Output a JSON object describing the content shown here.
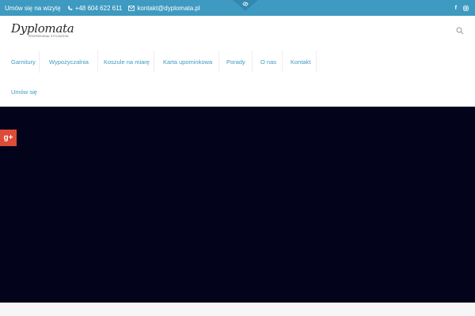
{
  "topbar": {
    "appointment": "Umów się na wizytę",
    "phone": "+48 604 622 611",
    "email": "kontakt@dyplomata.pl",
    "social": {
      "facebook": "f",
      "other": "ig"
    }
  },
  "header": {
    "logo_text": "Dyplomata",
    "logo_tagline": "PROFESSIONAL STYLIZATION"
  },
  "nav": {
    "items": [
      {
        "label": "Garnitury"
      },
      {
        "label": "Wypożyczalnia"
      },
      {
        "label": "Koszule na miarę"
      },
      {
        "label": "Karta upominkowa"
      },
      {
        "label": "Porady"
      },
      {
        "label": "O nas"
      },
      {
        "label": "Kontakt"
      },
      {
        "label": "Umów się"
      }
    ]
  },
  "share": {
    "gplus_label": "g+"
  },
  "colors": {
    "accent": "#3e9ac0",
    "hero": "#03031b",
    "gplus": "#dd4b39"
  }
}
